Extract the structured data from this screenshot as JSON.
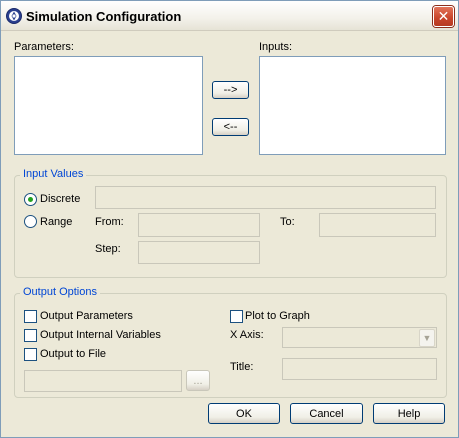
{
  "window": {
    "title": "Simulation Configuration",
    "close_glyph": "✕",
    "icon": "simulation-app-icon"
  },
  "lists": {
    "parameters_label": "Parameters:",
    "inputs_label": "Inputs:",
    "add_label": "-->",
    "remove_label": "<--"
  },
  "input_values": {
    "title": "Input Values",
    "discrete_label": "Discrete",
    "discrete_selected": true,
    "range_label": "Range",
    "from_label": "From:",
    "to_label": "To:",
    "step_label": "Step:"
  },
  "output_options": {
    "title": "Output Options",
    "output_parameters_label": "Output Parameters",
    "output_internal_variables_label": "Output Internal Variables",
    "output_to_file_label": "Output to File",
    "browse_label": "...",
    "plot_to_graph_label": "Plot to Graph",
    "x_axis_label": "X Axis:",
    "title_label": "Title:"
  },
  "buttons": {
    "ok": "OK",
    "cancel": "Cancel",
    "help": "Help"
  },
  "colors": {
    "window_bg": "#ece9d8",
    "group_title": "#0046d5",
    "close_button": "#c8442a",
    "radio_check": "#21a121"
  }
}
